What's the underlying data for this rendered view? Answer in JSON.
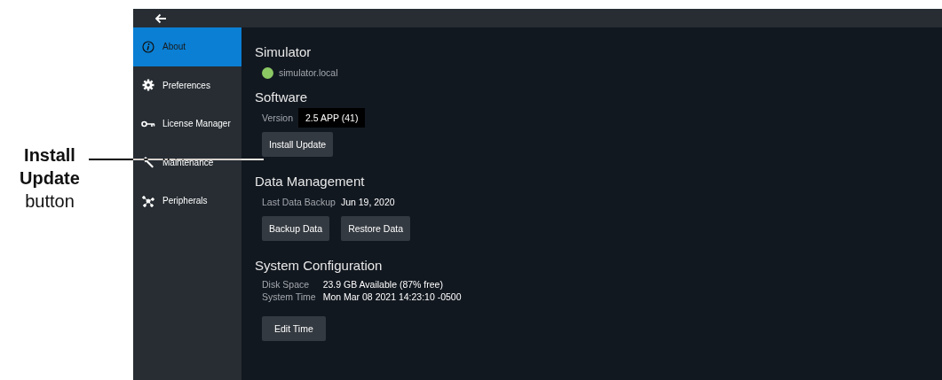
{
  "callout": {
    "lines": [
      "Install",
      "Update",
      "button"
    ]
  },
  "sidebar": {
    "items": [
      {
        "label": "About",
        "selected": true
      },
      {
        "label": "Preferences",
        "selected": false
      },
      {
        "label": "License Manager",
        "selected": false
      },
      {
        "label": "Maintenance",
        "selected": false
      },
      {
        "label": "Peripherals",
        "selected": false
      }
    ]
  },
  "device": {
    "title": "Simulator",
    "host": "simulator.local",
    "online": true
  },
  "software": {
    "title": "Software",
    "version_label": "Version",
    "version": "2.5 APP (41)",
    "button": "Install Update"
  },
  "data_management": {
    "title": "Data Management",
    "backup_label": "Last Data Backup",
    "backup_date": "Jun 19, 2020",
    "buttons": [
      "Backup Data",
      "Restore Data"
    ]
  },
  "system": {
    "title": "System Configuration",
    "rows": [
      {
        "label": "Disk Space",
        "value": "23.9 GB Available (87% free)"
      },
      {
        "label": "System Time",
        "value": "Mon Mar 08 2021 14:23:10 -0500"
      }
    ],
    "button": "Edit Time"
  }
}
